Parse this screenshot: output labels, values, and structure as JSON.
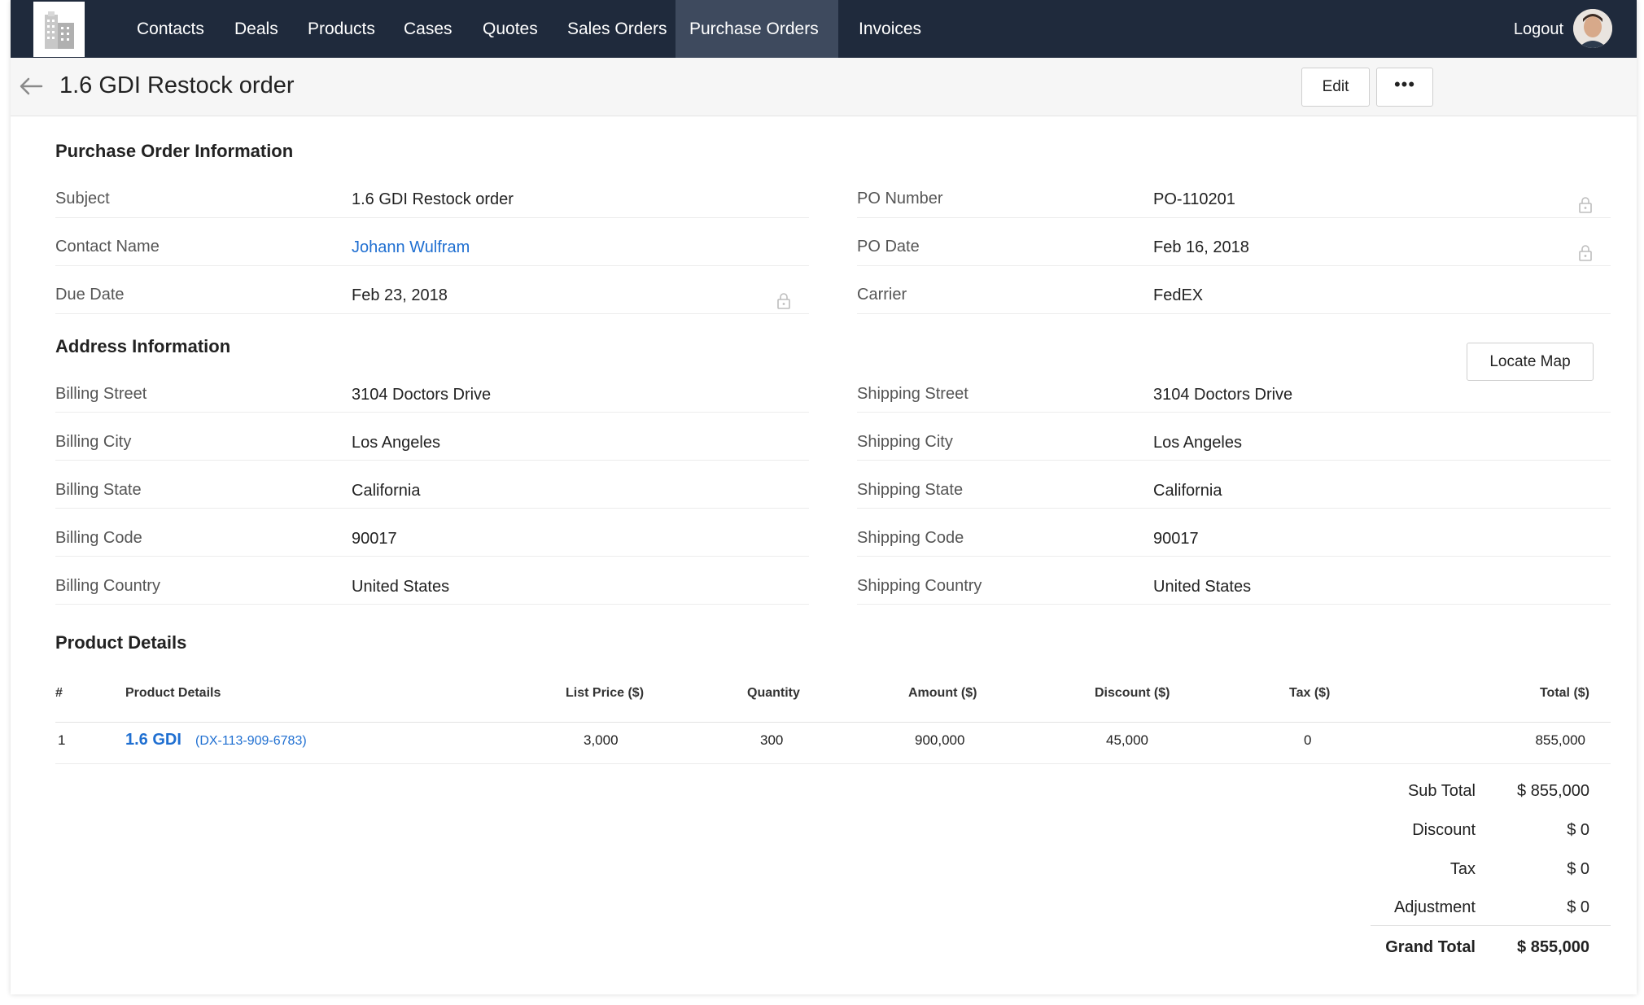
{
  "nav": {
    "items": [
      {
        "label": "Contacts"
      },
      {
        "label": "Deals"
      },
      {
        "label": "Products"
      },
      {
        "label": "Cases"
      },
      {
        "label": "Quotes"
      },
      {
        "label": "Sales Orders"
      },
      {
        "label": "Purchase Orders",
        "active": true
      },
      {
        "label": "Invoices"
      }
    ],
    "logout_label": "Logout"
  },
  "header": {
    "title": "1.6 GDI Restock order",
    "edit_label": "Edit",
    "more_label": "•••"
  },
  "po_info": {
    "section_title": "Purchase Order Information",
    "subject_label": "Subject",
    "subject_value": "1.6 GDI Restock order",
    "contact_label": "Contact Name",
    "contact_value": "Johann Wulfram",
    "due_label": "Due Date",
    "due_value": "Feb 23, 2018",
    "po_number_label": "PO Number",
    "po_number_value": "PO-110201",
    "po_date_label": "PO Date",
    "po_date_value": "Feb 16, 2018",
    "carrier_label": "Carrier",
    "carrier_value": "FedEX"
  },
  "address": {
    "section_title": "Address Information",
    "locate_map_label": "Locate Map",
    "billing_street_label": "Billing Street",
    "billing_street_value": "3104 Doctors Drive",
    "billing_city_label": "Billing City",
    "billing_city_value": "Los Angeles",
    "billing_state_label": "Billing State",
    "billing_state_value": "California",
    "billing_code_label": "Billing Code",
    "billing_code_value": "90017",
    "billing_country_label": "Billing Country",
    "billing_country_value": "United States",
    "shipping_street_label": "Shipping Street",
    "shipping_street_value": "3104 Doctors Drive",
    "shipping_city_label": "Shipping City",
    "shipping_city_value": "Los Angeles",
    "shipping_state_label": "Shipping State",
    "shipping_state_value": "California",
    "shipping_code_label": "Shipping Code",
    "shipping_code_value": "90017",
    "shipping_country_label": "Shipping Country",
    "shipping_country_value": "United States"
  },
  "products": {
    "section_title": "Product Details",
    "columns": [
      "#",
      "Product Details",
      "List Price ($)",
      "Quantity",
      "Amount ($)",
      "Discount ($)",
      "Tax ($)",
      "Total ($)"
    ],
    "rows": [
      {
        "index": "1",
        "name": "1.6 GDI",
        "code": "(DX-113-909-6783)",
        "list_price": "3,000",
        "quantity": "300",
        "amount": "900,000",
        "discount": "45,000",
        "tax": "0",
        "total": "855,000"
      }
    ]
  },
  "totals": {
    "sub_total_label": "Sub Total",
    "sub_total_value": "$ 855,000",
    "discount_label": "Discount",
    "discount_value": "$ 0",
    "tax_label": "Tax",
    "tax_value": "$ 0",
    "adjustment_label": "Adjustment",
    "adjustment_value": "$ 0",
    "grand_total_label": "Grand Total",
    "grand_total_value": "$ 855,000"
  },
  "colors": {
    "nav_bg": "#1f2a3c",
    "nav_active": "#3e4a5e",
    "link": "#1f6fd1"
  }
}
